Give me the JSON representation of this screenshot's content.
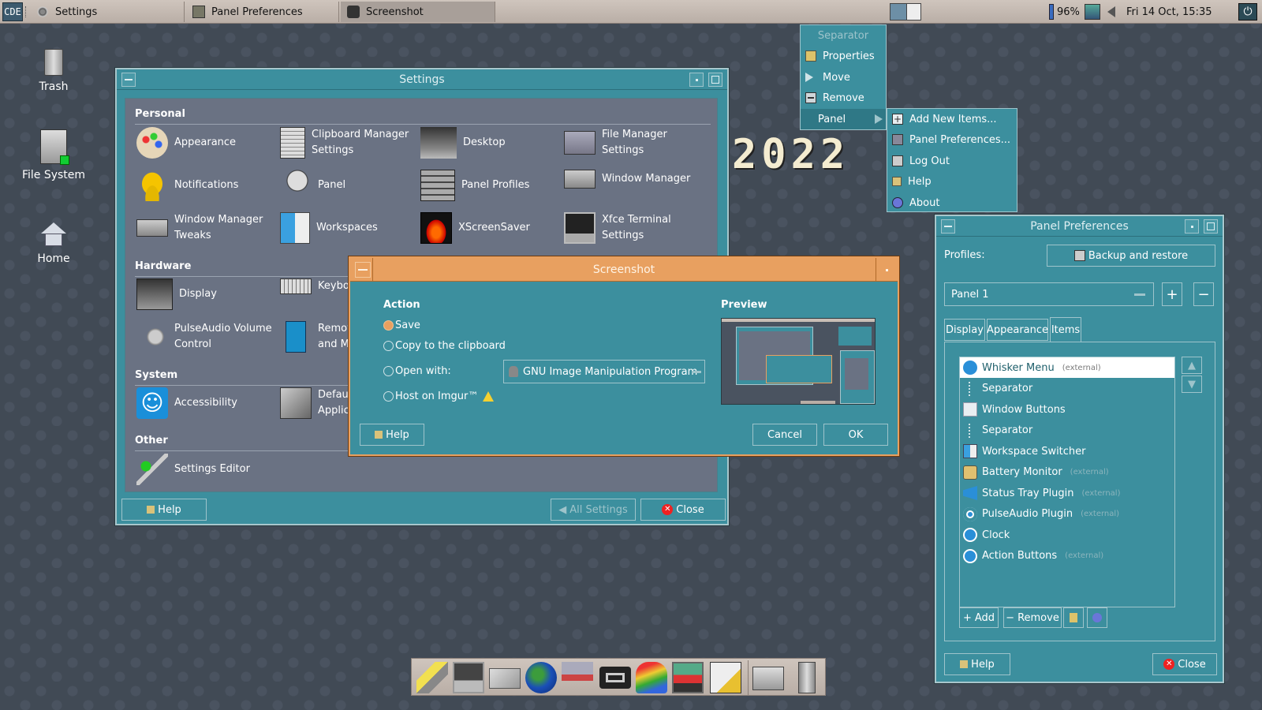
{
  "top_panel": {
    "tasks": [
      {
        "label": "Settings"
      },
      {
        "label": "Panel Preferences"
      },
      {
        "label": "Screenshot"
      }
    ],
    "battery": "96%",
    "clock": "Fri 14 Oct, 15:35"
  },
  "desktop": {
    "icons": [
      {
        "label": "Trash"
      },
      {
        "label": "File System"
      },
      {
        "label": "Home"
      }
    ],
    "year_text": "2022"
  },
  "settings": {
    "title": "Settings",
    "sections": {
      "personal": "Personal",
      "hardware": "Hardware",
      "system": "System",
      "other": "Other"
    },
    "personal_items": [
      {
        "l1": "Appearance",
        "l2": ""
      },
      {
        "l1": "Clipboard Manager",
        "l2": "Settings"
      },
      {
        "l1": "Desktop",
        "l2": ""
      },
      {
        "l1": "File Manager",
        "l2": "Settings"
      },
      {
        "l1": "Notifications",
        "l2": ""
      },
      {
        "l1": "Panel",
        "l2": ""
      },
      {
        "l1": "Panel Profiles",
        "l2": ""
      },
      {
        "l1": "Window Manager",
        "l2": ""
      },
      {
        "l1": "Window Manager",
        "l2": "Tweaks"
      },
      {
        "l1": "Workspaces",
        "l2": ""
      },
      {
        "l1": "XScreenSaver",
        "l2": ""
      },
      {
        "l1": "Xfce Terminal",
        "l2": "Settings"
      }
    ],
    "hardware_items": [
      {
        "l1": "Display",
        "l2": ""
      },
      {
        "l1": "Keyboa",
        "l2": ""
      },
      {
        "l1": "PulseAudio Volume",
        "l2": "Control"
      },
      {
        "l1": "Remov",
        "l2": "and Me"
      }
    ],
    "system_items": [
      {
        "l1": "Accessibility",
        "l2": ""
      },
      {
        "l1": "Defaul",
        "l2": "Applica"
      }
    ],
    "other_items": [
      {
        "l1": "Settings Editor",
        "l2": ""
      }
    ],
    "help_label": "Help",
    "all_settings_label": "All Settings",
    "close_label": "Close"
  },
  "context_menu": {
    "items": [
      "Separator",
      "Properties",
      "Move",
      "Remove",
      "Panel"
    ],
    "submenu": [
      "Add New Items...",
      "Panel Preferences...",
      "Log Out",
      "Help",
      "About"
    ]
  },
  "panel_prefs": {
    "title": "Panel Preferences",
    "profiles_label": "Profiles:",
    "backup_label": "Backup and restore",
    "panel_select": "Panel 1",
    "tabs": [
      "Display",
      "Appearance",
      "Items"
    ],
    "items": [
      {
        "name": "Whisker Menu",
        "ext": "(external)"
      },
      {
        "name": "Separator",
        "ext": ""
      },
      {
        "name": "Window Buttons",
        "ext": ""
      },
      {
        "name": "Separator",
        "ext": ""
      },
      {
        "name": "Workspace Switcher",
        "ext": ""
      },
      {
        "name": "Battery Monitor",
        "ext": "(external)"
      },
      {
        "name": "Status Tray Plugin",
        "ext": "(external)"
      },
      {
        "name": "PulseAudio Plugin",
        "ext": "(external)"
      },
      {
        "name": "Clock",
        "ext": ""
      },
      {
        "name": "Action Buttons",
        "ext": "(external)"
      }
    ],
    "add_label": "Add",
    "remove_label": "Remove",
    "help_label": "Help",
    "close_label": "Close"
  },
  "screenshot": {
    "title": "Screenshot",
    "action_label": "Action",
    "preview_label": "Preview",
    "options": [
      "Save",
      "Copy to the clipboard",
      "Open with:",
      "Host on Imgur™"
    ],
    "open_with_value": "GNU Image Manipulation Program",
    "help_label": "Help",
    "cancel_label": "Cancel",
    "ok_label": "OK"
  },
  "colors": {
    "window_teal": "#3c8f9e",
    "content_gray": "#6a7283",
    "screenshot_titlebar": "#e8a060"
  }
}
